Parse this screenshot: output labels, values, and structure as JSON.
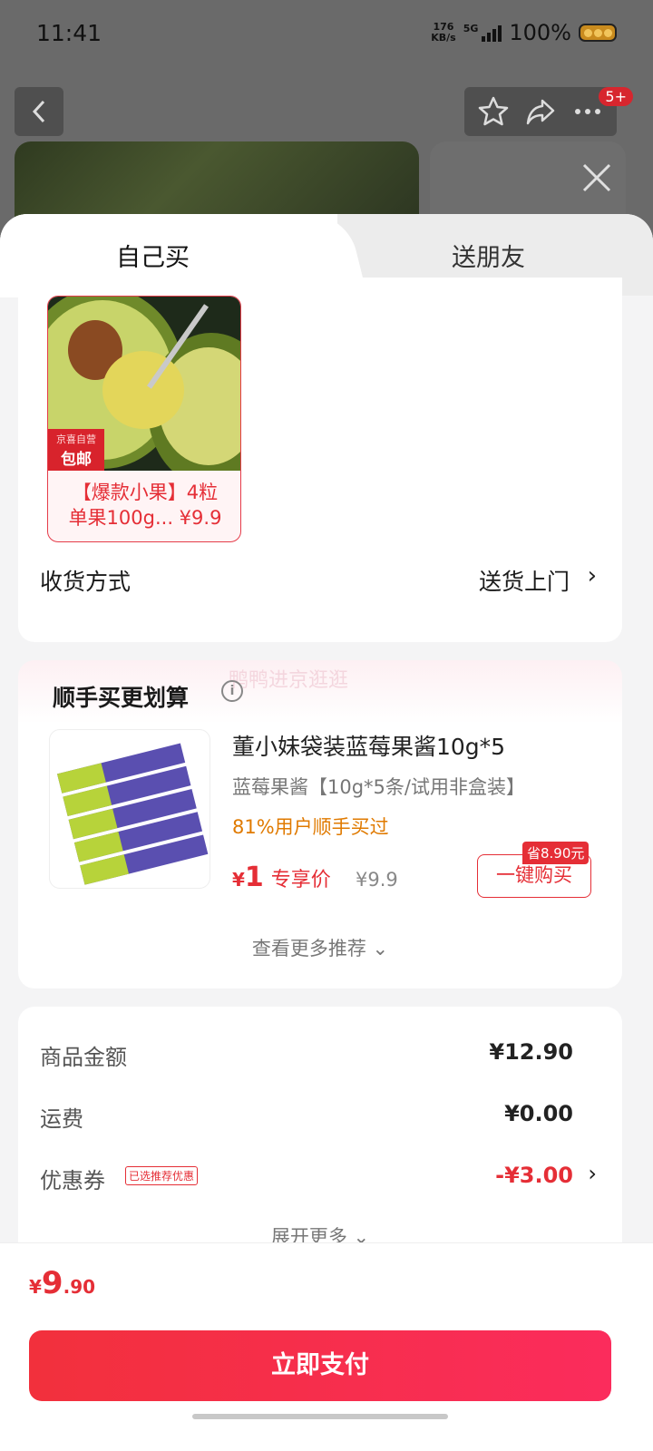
{
  "status_bar": {
    "time": "11:41",
    "net_speed_value": "176",
    "net_speed_unit": "KB/s",
    "network": "5G",
    "battery": "100%"
  },
  "nav": {
    "back_icon": "chevron-left-icon",
    "favorite_icon": "star-icon",
    "share_icon": "share-icon",
    "more_icon": "more-icon",
    "badge": "5+"
  },
  "tabs": [
    {
      "label": "自己买",
      "active": true
    },
    {
      "label": "送朋友",
      "active": false
    }
  ],
  "product": {
    "tag_top": "京喜自营",
    "tag_bottom": "包邮",
    "title_line1": "【爆款小果】4粒",
    "title_line2": "单果100g... ¥9.9"
  },
  "shipping": {
    "label": "收货方式",
    "value": "送货上门"
  },
  "recommend": {
    "watermark": "鸭鸭进京逛逛",
    "title": "顺手买更划算",
    "item": {
      "name": "董小妹袋装蓝莓果酱10g*5",
      "spec": "蓝莓果酱【10g*5条/试用非盒装】",
      "bought": "81%用户顺手买过",
      "price_symbol": "¥",
      "price": "1",
      "price_label": "专享价",
      "original_price": "¥9.9",
      "save_badge": "省8.90元",
      "buy_label": "一键购买"
    },
    "more_label": "查看更多推荐"
  },
  "summary": {
    "rows": [
      {
        "label": "商品金额",
        "value": "¥12.90"
      },
      {
        "label": "运费",
        "value": "¥0.00"
      },
      {
        "label": "优惠券",
        "value": "-¥3.00",
        "tag": "已选推荐优惠"
      }
    ],
    "expand_label": "展开更多"
  },
  "footer": {
    "total_symbol": "¥",
    "total_int": "9",
    "total_dec": ".90",
    "pay_label": "立即支付"
  },
  "colors": {
    "accent": "#e52e36",
    "orange": "#e07a00",
    "pay_gradient_start": "#f2303c",
    "pay_gradient_end": "#fb2c5c"
  }
}
